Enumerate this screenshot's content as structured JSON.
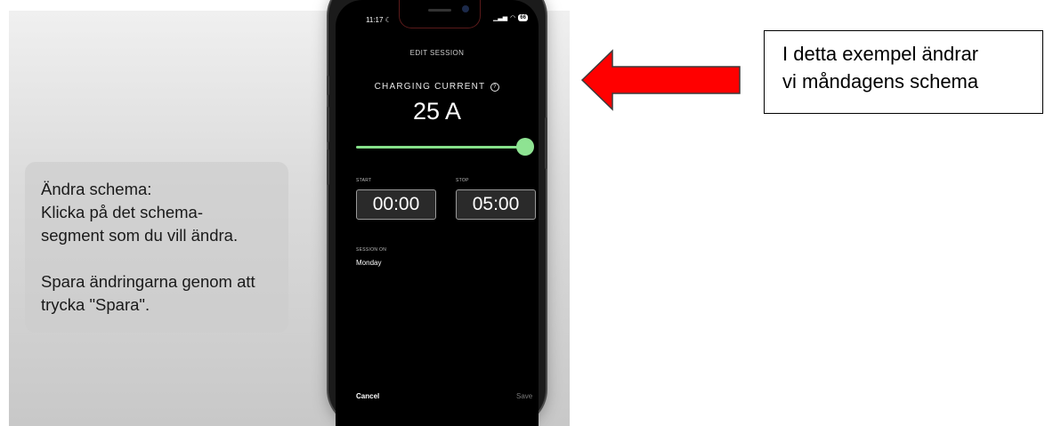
{
  "info_card": {
    "line1": "Ändra schema:",
    "line2": "Klicka på det schema-",
    "line3": "segment som du vill ändra.",
    "line4": "Spara ändringarna genom att",
    "line5": "trycka \"Spara\"."
  },
  "phone": {
    "status_time": "11:17",
    "battery": "66",
    "title": "EDIT SESSION",
    "current_label": "CHARGING CURRENT",
    "current_value": "25 A",
    "slider_fraction": 1.0,
    "start_label": "START",
    "start_value": "00:00",
    "stop_label": "STOP",
    "stop_value": "05:00",
    "session_label": "SESSION ON",
    "session_day": "Monday",
    "cancel_label": "Cancel",
    "save_label": "Save"
  },
  "callout": {
    "line1": "I detta exempel ändrar",
    "line2": "vi måndagens schema"
  },
  "colors": {
    "slider": "#86e08a",
    "arrow_fill": "#ff0000",
    "screen_bg": "#000000"
  }
}
